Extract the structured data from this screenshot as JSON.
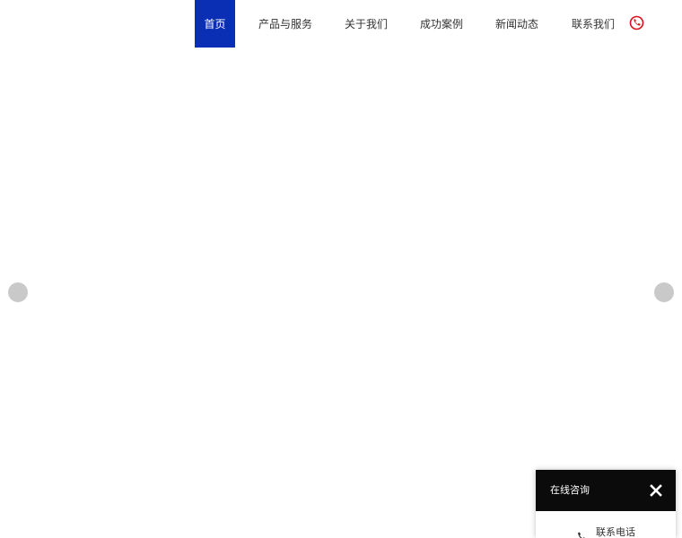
{
  "nav": {
    "items": [
      {
        "label": "首页",
        "active": true
      },
      {
        "label": "产品与服务",
        "active": false
      },
      {
        "label": "关于我们",
        "active": false
      },
      {
        "label": "成功案例",
        "active": false
      },
      {
        "label": "新闻动态",
        "active": false
      },
      {
        "label": "联系我们",
        "active": false
      }
    ],
    "phone_icon": "phone-circle-icon",
    "active_color": "#0a2fb4",
    "phone_icon_color": "#d8111b"
  },
  "banner": {
    "prev_icon": "slider-prev-arrow",
    "next_icon": "slider-next-arrow"
  },
  "consult": {
    "title": "在线咨询",
    "close_icon": "close-icon",
    "phone_label": "联系电话",
    "phone_icon": "phone-icon"
  }
}
